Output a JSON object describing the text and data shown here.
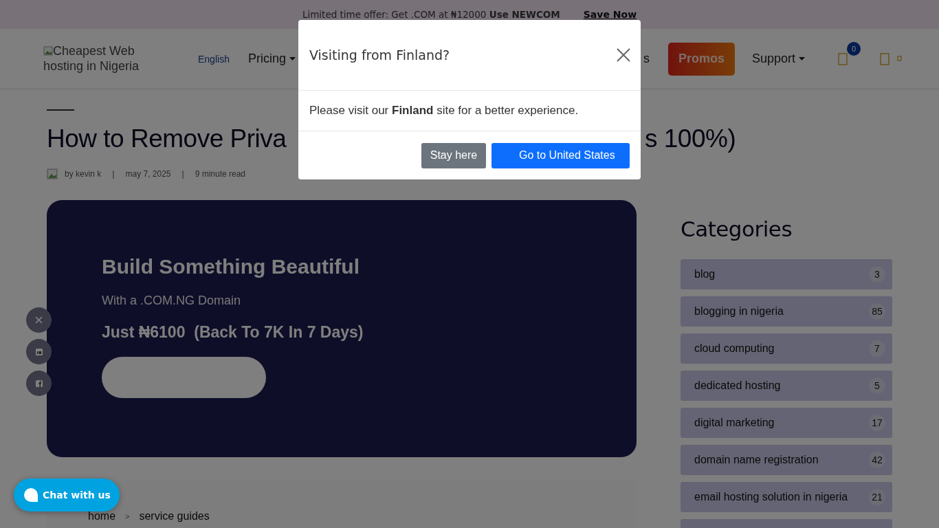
{
  "promo_bar": {
    "text": "Limited time offer: Get .COM at ₦12000 **Use NEWCOM**",
    "link": "Save Now"
  },
  "header": {
    "logo_alt": "Cheapest Web hosting in Nigeria",
    "language": "English",
    "nav": [
      {
        "label": "Pricing",
        "kind": "dropdown"
      },
      {
        "label": "s",
        "kind": "link"
      },
      {
        "label": "Promos",
        "kind": "promo"
      },
      {
        "label": "Support",
        "kind": "dropdown"
      }
    ],
    "cart_count": "0"
  },
  "article": {
    "title_start": "How to Remove Priva",
    "title_end": "s 100%)",
    "meta": [
      "by kevin k",
      "|",
      "may 7, 2025",
      "|",
      "9 minute read"
    ],
    "banner": {
      "title": "Build Something Beautiful",
      "subtitle": "With a .COM.NG Domain",
      "price": "Just ₦6100  (Back To 7K In 7 Days)"
    },
    "breadcrumb": [
      "home",
      ">",
      "service guides"
    ]
  },
  "sidebar": {
    "heading": "Categories",
    "categories": [
      {
        "name": "blog",
        "count": "3"
      },
      {
        "name": "blogging in nigeria",
        "count": "85"
      },
      {
        "name": "cloud computing",
        "count": "7"
      },
      {
        "name": "dedicated hosting",
        "count": "5"
      },
      {
        "name": "digital marketing",
        "count": "17"
      },
      {
        "name": "domain name registration",
        "count": "42"
      },
      {
        "name": "email hosting solution in nigeria",
        "count": "21"
      }
    ]
  },
  "social": [
    {
      "kind": "x"
    },
    {
      "kind": "linkedin"
    },
    {
      "kind": "facebook"
    }
  ],
  "chat": {
    "label": "Chat with us"
  },
  "modal": {
    "title": "Visiting from Finland?",
    "body": "Please visit our **Finland** site for a better experience.",
    "buttons": [
      {
        "label": "Stay here",
        "kind": "secondary"
      },
      {
        "label": "Go to United States",
        "kind": "primary"
      }
    ]
  }
}
